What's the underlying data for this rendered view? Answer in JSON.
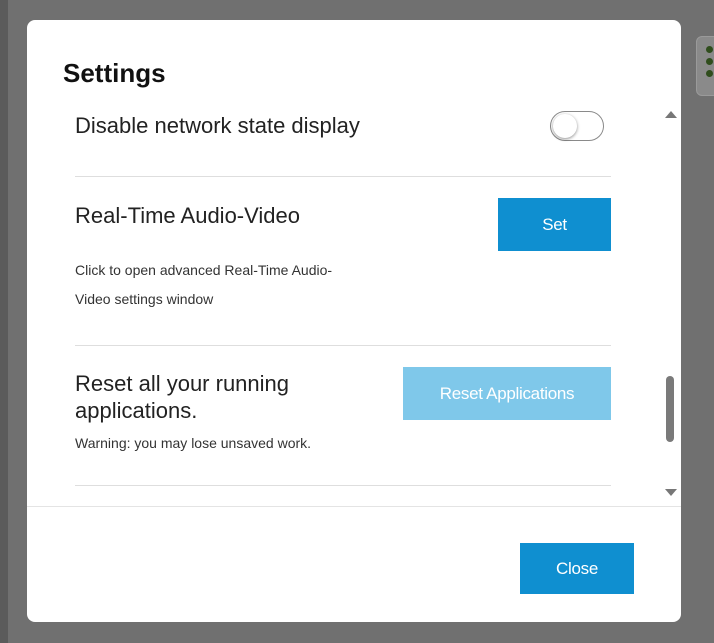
{
  "dialog": {
    "title": "Settings"
  },
  "settings": {
    "network_state": {
      "label": "Disable network state display",
      "enabled": false
    },
    "audio_video": {
      "label": "Real-Time Audio-Video",
      "button_label": "Set",
      "description_line1": "Click to open advanced Real-Time Audio-",
      "description_line2": "Video settings window"
    },
    "reset": {
      "label_line1": "Reset all your running",
      "label_line2": "applications.",
      "warning": "Warning: you may lose unsaved work.",
      "button_label": "Reset Applications",
      "button_enabled": false
    }
  },
  "footer": {
    "close_label": "Close"
  },
  "colors": {
    "primary": "#0f8fd0",
    "primary_disabled": "#7fc8ea",
    "overlay": "#707070"
  },
  "icons": {
    "scroll_up": "triangle-up",
    "scroll_down": "triangle-down"
  }
}
